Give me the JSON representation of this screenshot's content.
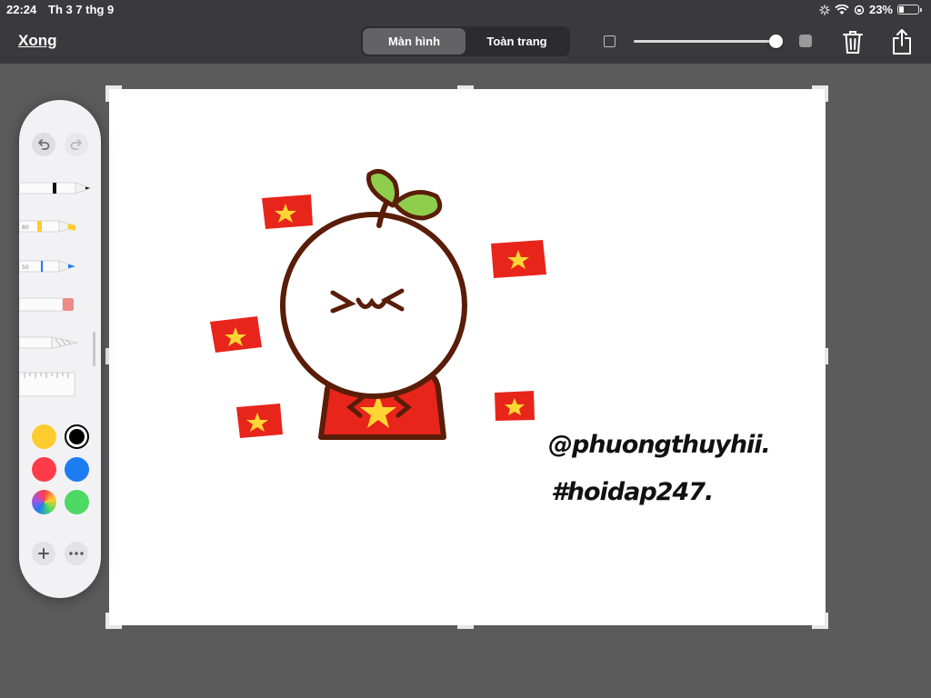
{
  "status_bar": {
    "time": "22:24",
    "date": "Th 3 7 thg 9",
    "battery_percent": "23%",
    "battery_level": 0.23
  },
  "toolbar": {
    "done_label": "Xong",
    "segments": [
      {
        "label": "Màn hình",
        "active": true
      },
      {
        "label": "Toàn trang",
        "active": false
      }
    ],
    "zoom_level": 0.98
  },
  "canvas": {
    "handle_line1": "@phuongthuyhii.",
    "handle_line2": "#hoidap247."
  },
  "palette": {
    "colors": [
      {
        "name": "yellow",
        "hex": "#ffcc2f"
      },
      {
        "name": "black",
        "hex": "#000000",
        "selected": true
      },
      {
        "name": "red",
        "hex": "#ff3b4a"
      },
      {
        "name": "blue",
        "hex": "#1d7cf2"
      },
      {
        "name": "multicolor",
        "hex": "conic"
      },
      {
        "name": "green",
        "hex": "#4cd964"
      }
    ],
    "icons": [
      "undo-icon",
      "redo-icon",
      "pen-tool",
      "marker-tool",
      "pencil-tool",
      "eraser-tool",
      "lasso-tool",
      "ruler-tool",
      "add-icon",
      "more-icon"
    ]
  },
  "drawing_colors": {
    "flag_red": "#e8251b",
    "star_yellow": "#ffd633",
    "outline_brown": "#5a1d08",
    "leaf_green": "#8fce4c"
  }
}
